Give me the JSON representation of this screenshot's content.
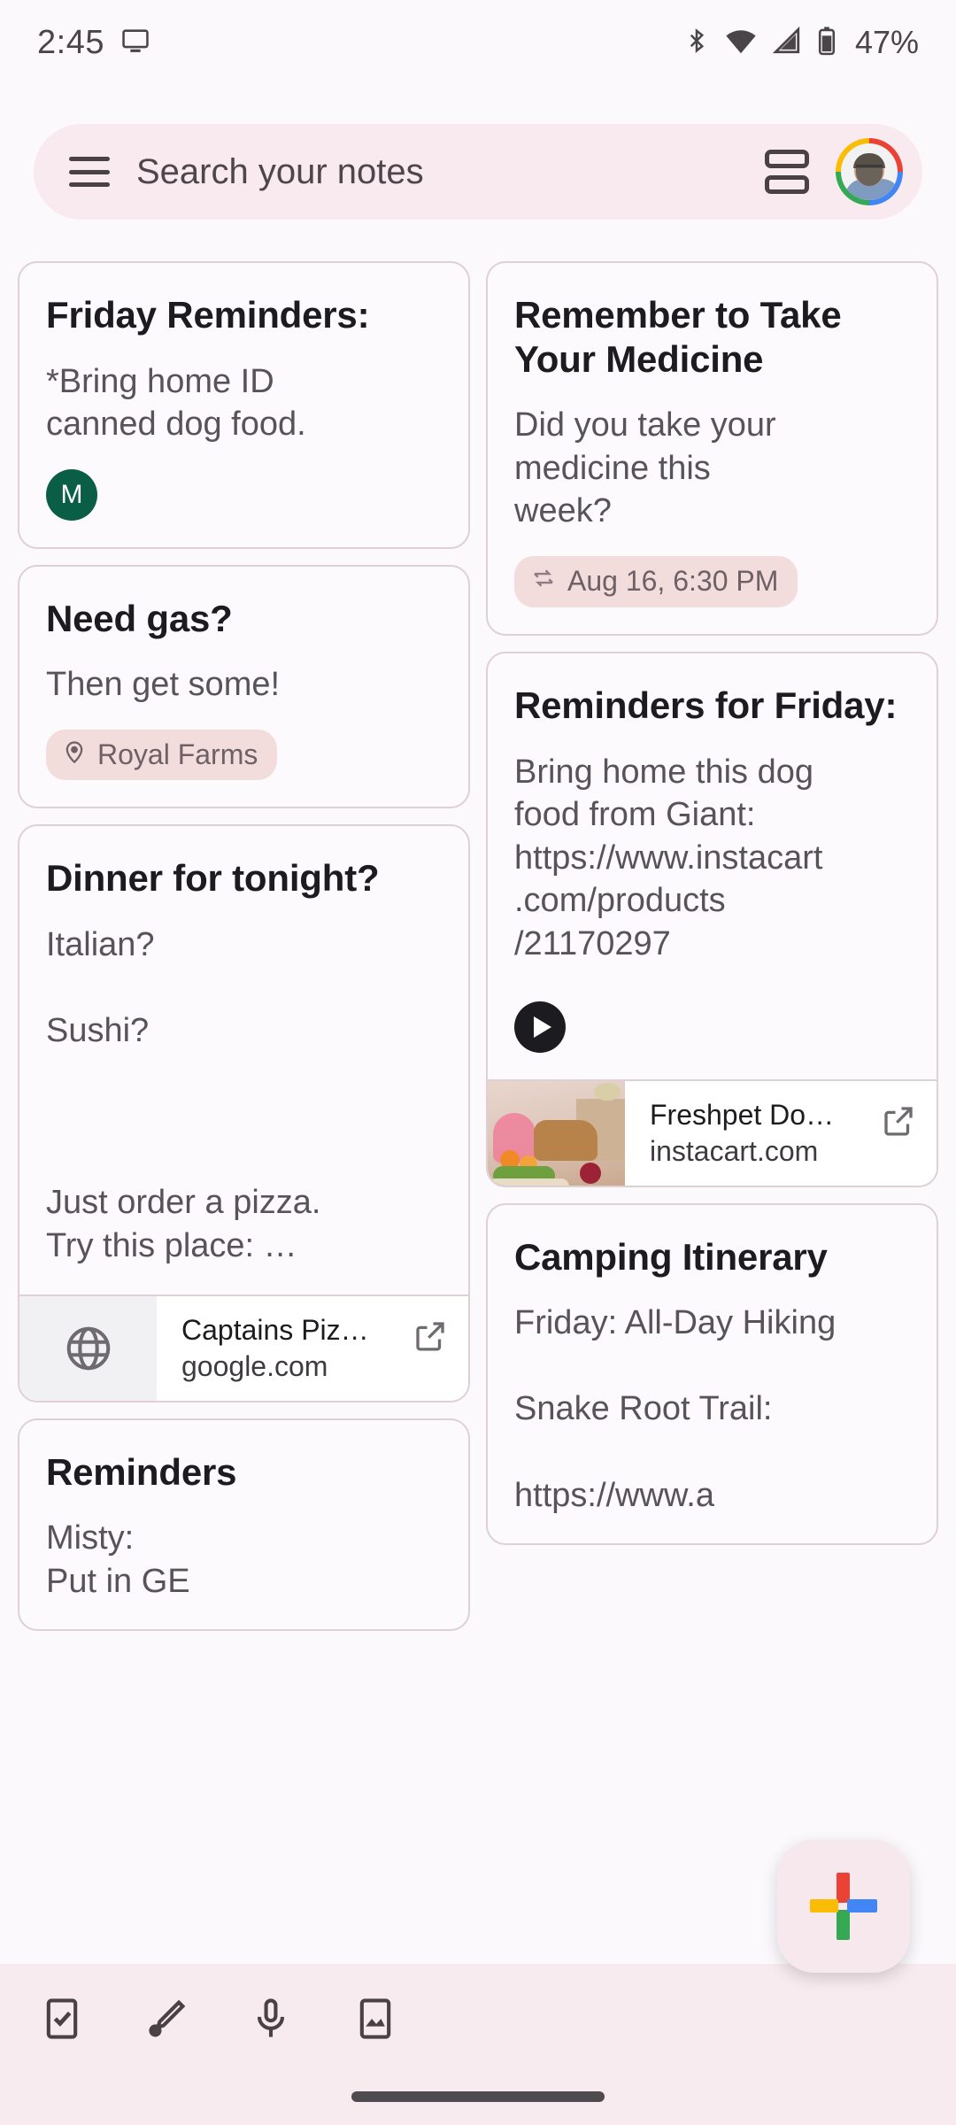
{
  "status_bar": {
    "time": "2:45",
    "cast_icon": "monitor-icon",
    "bluetooth_icon": "bluetooth-icon",
    "wifi_icon": "wifi-icon",
    "signal_icon": "cellular-signal-icon",
    "battery_icon": "battery-icon",
    "battery_percent": "47%"
  },
  "search": {
    "menu_icon": "hamburger-menu-icon",
    "placeholder": "Search your notes",
    "view_toggle_icon": "list-view-toggle-icon",
    "avatar_label": "account-avatar"
  },
  "notes": {
    "left": [
      {
        "title": "Friday Reminders:",
        "body": "*Bring home ID\ncanned dog food.",
        "collaborator": "M",
        "collaborator_color": "#0B5E46"
      },
      {
        "title": "Need gas?",
        "body": "Then get some!",
        "chip": {
          "icon": "location-pin-icon",
          "label": "Royal Farms",
          "color": "#F3DCDC"
        }
      },
      {
        "title": "Dinner for tonight?",
        "body": "Italian?\n\nSushi?\n\n\n\nJust order a pizza.\nTry this place: …",
        "link_preview": {
          "thumb_icon": "globe-icon",
          "title": "Captains Piz…",
          "domain": "google.com",
          "open_icon": "open-in-new-icon"
        }
      },
      {
        "title": "Reminders",
        "body": "Misty:\nPut in GE"
      }
    ],
    "right": [
      {
        "title": "Remember\nto Take Your\nMedicine",
        "body": "Did you take your\nmedicine this\nweek?",
        "chip": {
          "icon": "repeat-icon",
          "label": "Aug 16, 6:30 PM",
          "color": "#F3DCDC"
        }
      },
      {
        "title": "Reminders for Friday:",
        "body": "Bring home this dog\nfood from Giant:\nhttps://www.instacart\n.com/products\n/21170297",
        "audio_icon": "play-audio-icon",
        "link_preview": {
          "thumb_icon": "grocery-photo-thumbnail",
          "title": "Freshpet Do…",
          "domain": "instacart.com",
          "open_icon": "open-in-new-icon"
        }
      },
      {
        "title": "Camping Itinerary",
        "body": "Friday: All-Day Hiking\n\nSnake Root Trail:\n\nhttps://www.a"
      }
    ]
  },
  "fab": {
    "icon": "google-plus-new-note-icon",
    "label": "New note"
  },
  "bottom_bar": {
    "items": [
      {
        "icon": "new-list-icon",
        "label": "New list"
      },
      {
        "icon": "new-drawing-icon",
        "label": "New drawing"
      },
      {
        "icon": "new-voice-note-icon",
        "label": "New recording"
      },
      {
        "icon": "new-image-note-icon",
        "label": "New note with image"
      }
    ],
    "gesture_bar": "home-gesture-bar"
  },
  "theme": {
    "background": "#FBF9FC",
    "card_border": "#DFD0D4",
    "accent_pink": "#F8EAEE",
    "chip_pink": "#F3DCDC",
    "text_primary": "#1C1B1F",
    "text_secondary": "#58525A"
  }
}
